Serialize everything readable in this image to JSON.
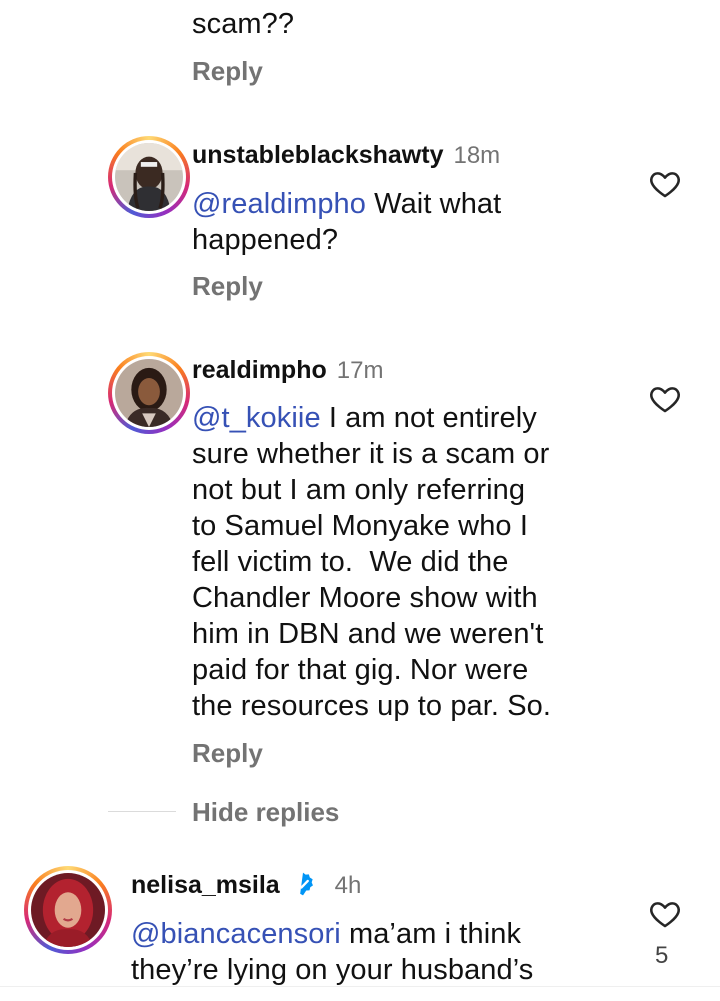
{
  "top_comment": {
    "last_line": "scam??",
    "reply_label": "Reply"
  },
  "comments": [
    {
      "username": "unstableblackshawty",
      "time": "18m",
      "mention": "@realdimpho",
      "lines": [
        " Wait what",
        "happened?"
      ],
      "reply_label": "Reply"
    },
    {
      "username": "realdimpho",
      "time": "17m",
      "mention": "@t_kokiie",
      "lines": [
        " I am not entirely",
        "sure whether it is a scam or",
        "not but I am only referring",
        "to Samuel Monyake who I",
        "fell victim to.  We did the",
        "Chandler Moore show with",
        "him in DBN and we weren't",
        "paid for that gig. Nor were",
        "the resources up to par. So."
      ],
      "reply_label": "Reply"
    },
    {
      "username": "nelisa_msila",
      "time": "4h",
      "mention": "@biancacensori",
      "lines": [
        " ma’am i think",
        "they’re lying on your husband’s"
      ],
      "like_count": "5"
    }
  ],
  "hide_replies_label": "Hide replies",
  "icons": {
    "heart": "heart-outline-icon",
    "verified": "verified-badge-icon"
  },
  "colors": {
    "mention": "#3651b5",
    "secondary_text": "#737373",
    "verified": "#0095f6"
  }
}
